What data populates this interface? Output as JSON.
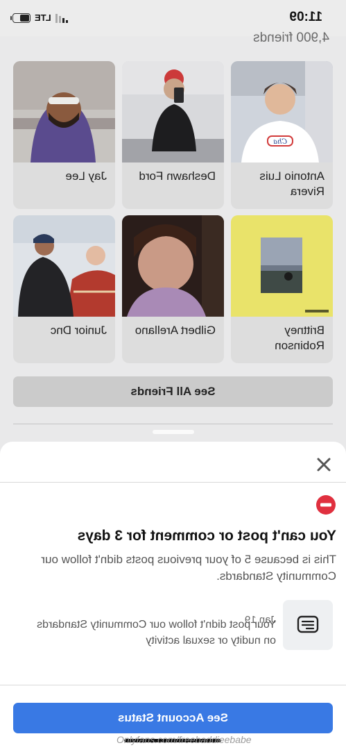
{
  "status_bar": {
    "time": "11:09",
    "network": "LTE"
  },
  "friends_section": {
    "count_text": "4,900 friends",
    "friends": [
      {
        "name": "Antonio Luis Rivera"
      },
      {
        "name": "Deshawn Ford"
      },
      {
        "name": "Jay Lee"
      },
      {
        "name": "Brittney Robinson"
      },
      {
        "name": "Gilbert Arellano"
      },
      {
        "name": "Junior Dnc"
      }
    ],
    "see_all_label": "See All Friends"
  },
  "sheet": {
    "title": "You can't post or comment for 3 days",
    "body": "This is because 5 of your previous posts didn't follow our Community Standards.",
    "post": {
      "date": "Jan 19",
      "text": "Your post didn't follow our Community Standards on nudity or sexual activity"
    },
    "button_label": "See Account Status"
  },
  "watermark": "Onlyfans.com/freebaddieebabe",
  "colors": {
    "accent": "#3979e4",
    "stop_icon": "#e0303f"
  }
}
